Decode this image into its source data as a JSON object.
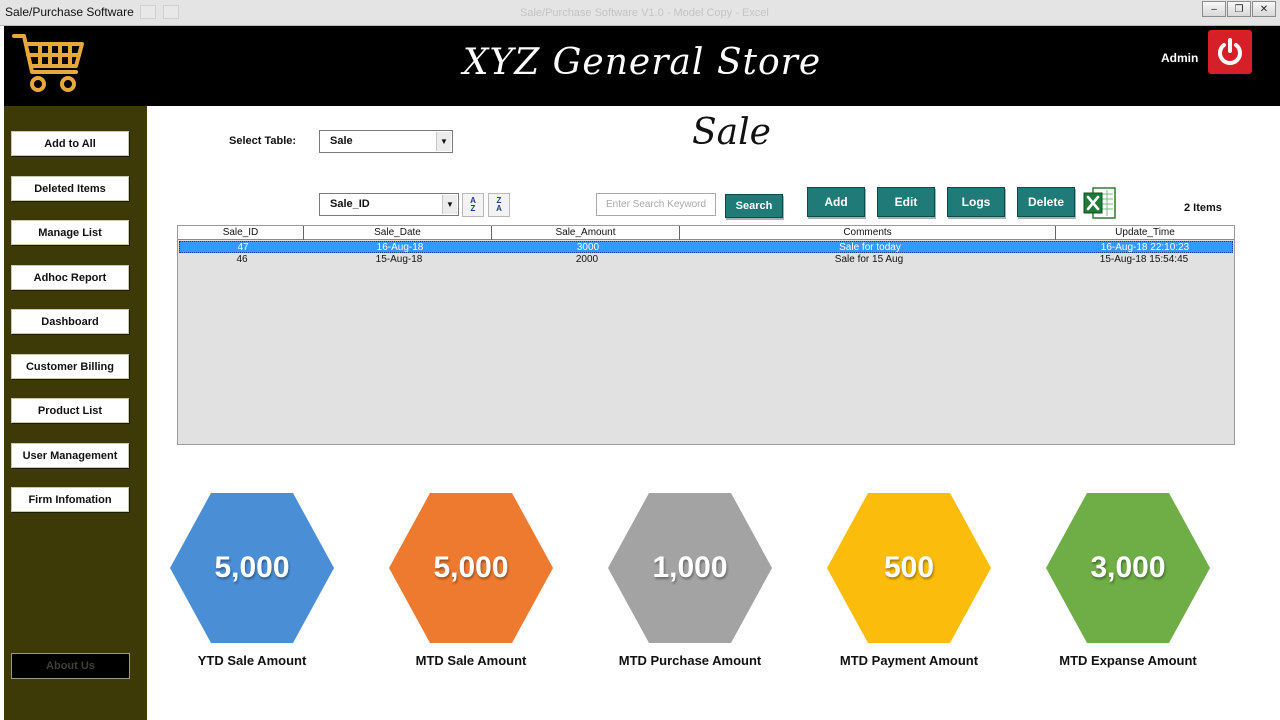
{
  "window": {
    "app_title": "Sale/Purchase Software",
    "faded_caption": "Sale/Purchase Software V1.0 - Model Copy - Excel"
  },
  "header": {
    "store_name": "XYZ General Store",
    "user": "Admin"
  },
  "sidebar": {
    "items": [
      {
        "label": "Add to All"
      },
      {
        "label": "Deleted Items"
      },
      {
        "label": "Manage List"
      },
      {
        "label": "Adhoc Report"
      },
      {
        "label": "Dashboard"
      },
      {
        "label": "Customer Billing"
      },
      {
        "label": "Product List"
      },
      {
        "label": "User Management"
      },
      {
        "label": "Firm Infomation"
      }
    ],
    "about": "About Us"
  },
  "main": {
    "select_label": "Select Table:",
    "selected_table": "Sale",
    "page_title": "Sale",
    "sort_field": "Sale_ID",
    "search_placeholder": "Enter Search Keyword",
    "search_label": "Search",
    "add_label": "Add",
    "edit_label": "Edit",
    "logs_label": "Logs",
    "delete_label": "Delete",
    "items_count": "2 Items",
    "sort_asc": {
      "top": "A",
      "bottom": "Z"
    },
    "sort_desc": {
      "top": "Z",
      "bottom": "A"
    }
  },
  "table": {
    "columns": [
      "Sale_ID",
      "Sale_Date",
      "Sale_Amount",
      "Comments",
      "Update_Time"
    ],
    "rows": [
      {
        "id": "47",
        "date": "16-Aug-18",
        "amount": "3000",
        "comments": "Sale for today",
        "updated": "16-Aug-18 22:10:23",
        "selected": true
      },
      {
        "id": "46",
        "date": "15-Aug-18",
        "amount": "2000",
        "comments": "Sale for 15 Aug",
        "updated": "15-Aug-18 15:54:45",
        "selected": false
      }
    ]
  },
  "kpis": [
    {
      "value": "5,000",
      "label": "YTD Sale Amount",
      "color": "#4a8fd6"
    },
    {
      "value": "5,000",
      "label": "MTD Sale Amount",
      "color": "#ee7a30"
    },
    {
      "value": "1,000",
      "label": "MTD Purchase Amount",
      "color": "#a3a3a3"
    },
    {
      "value": "500",
      "label": "MTD Payment Amount",
      "color": "#fbbc0b"
    },
    {
      "value": "3,000",
      "label": "MTD Expanse Amount",
      "color": "#6fad46"
    }
  ],
  "colors": {
    "header": "#000000",
    "sidebar": "#3d3a08",
    "action_button": "#1f7a78",
    "selected_row": "#3399ff",
    "power": "#d61f26"
  }
}
